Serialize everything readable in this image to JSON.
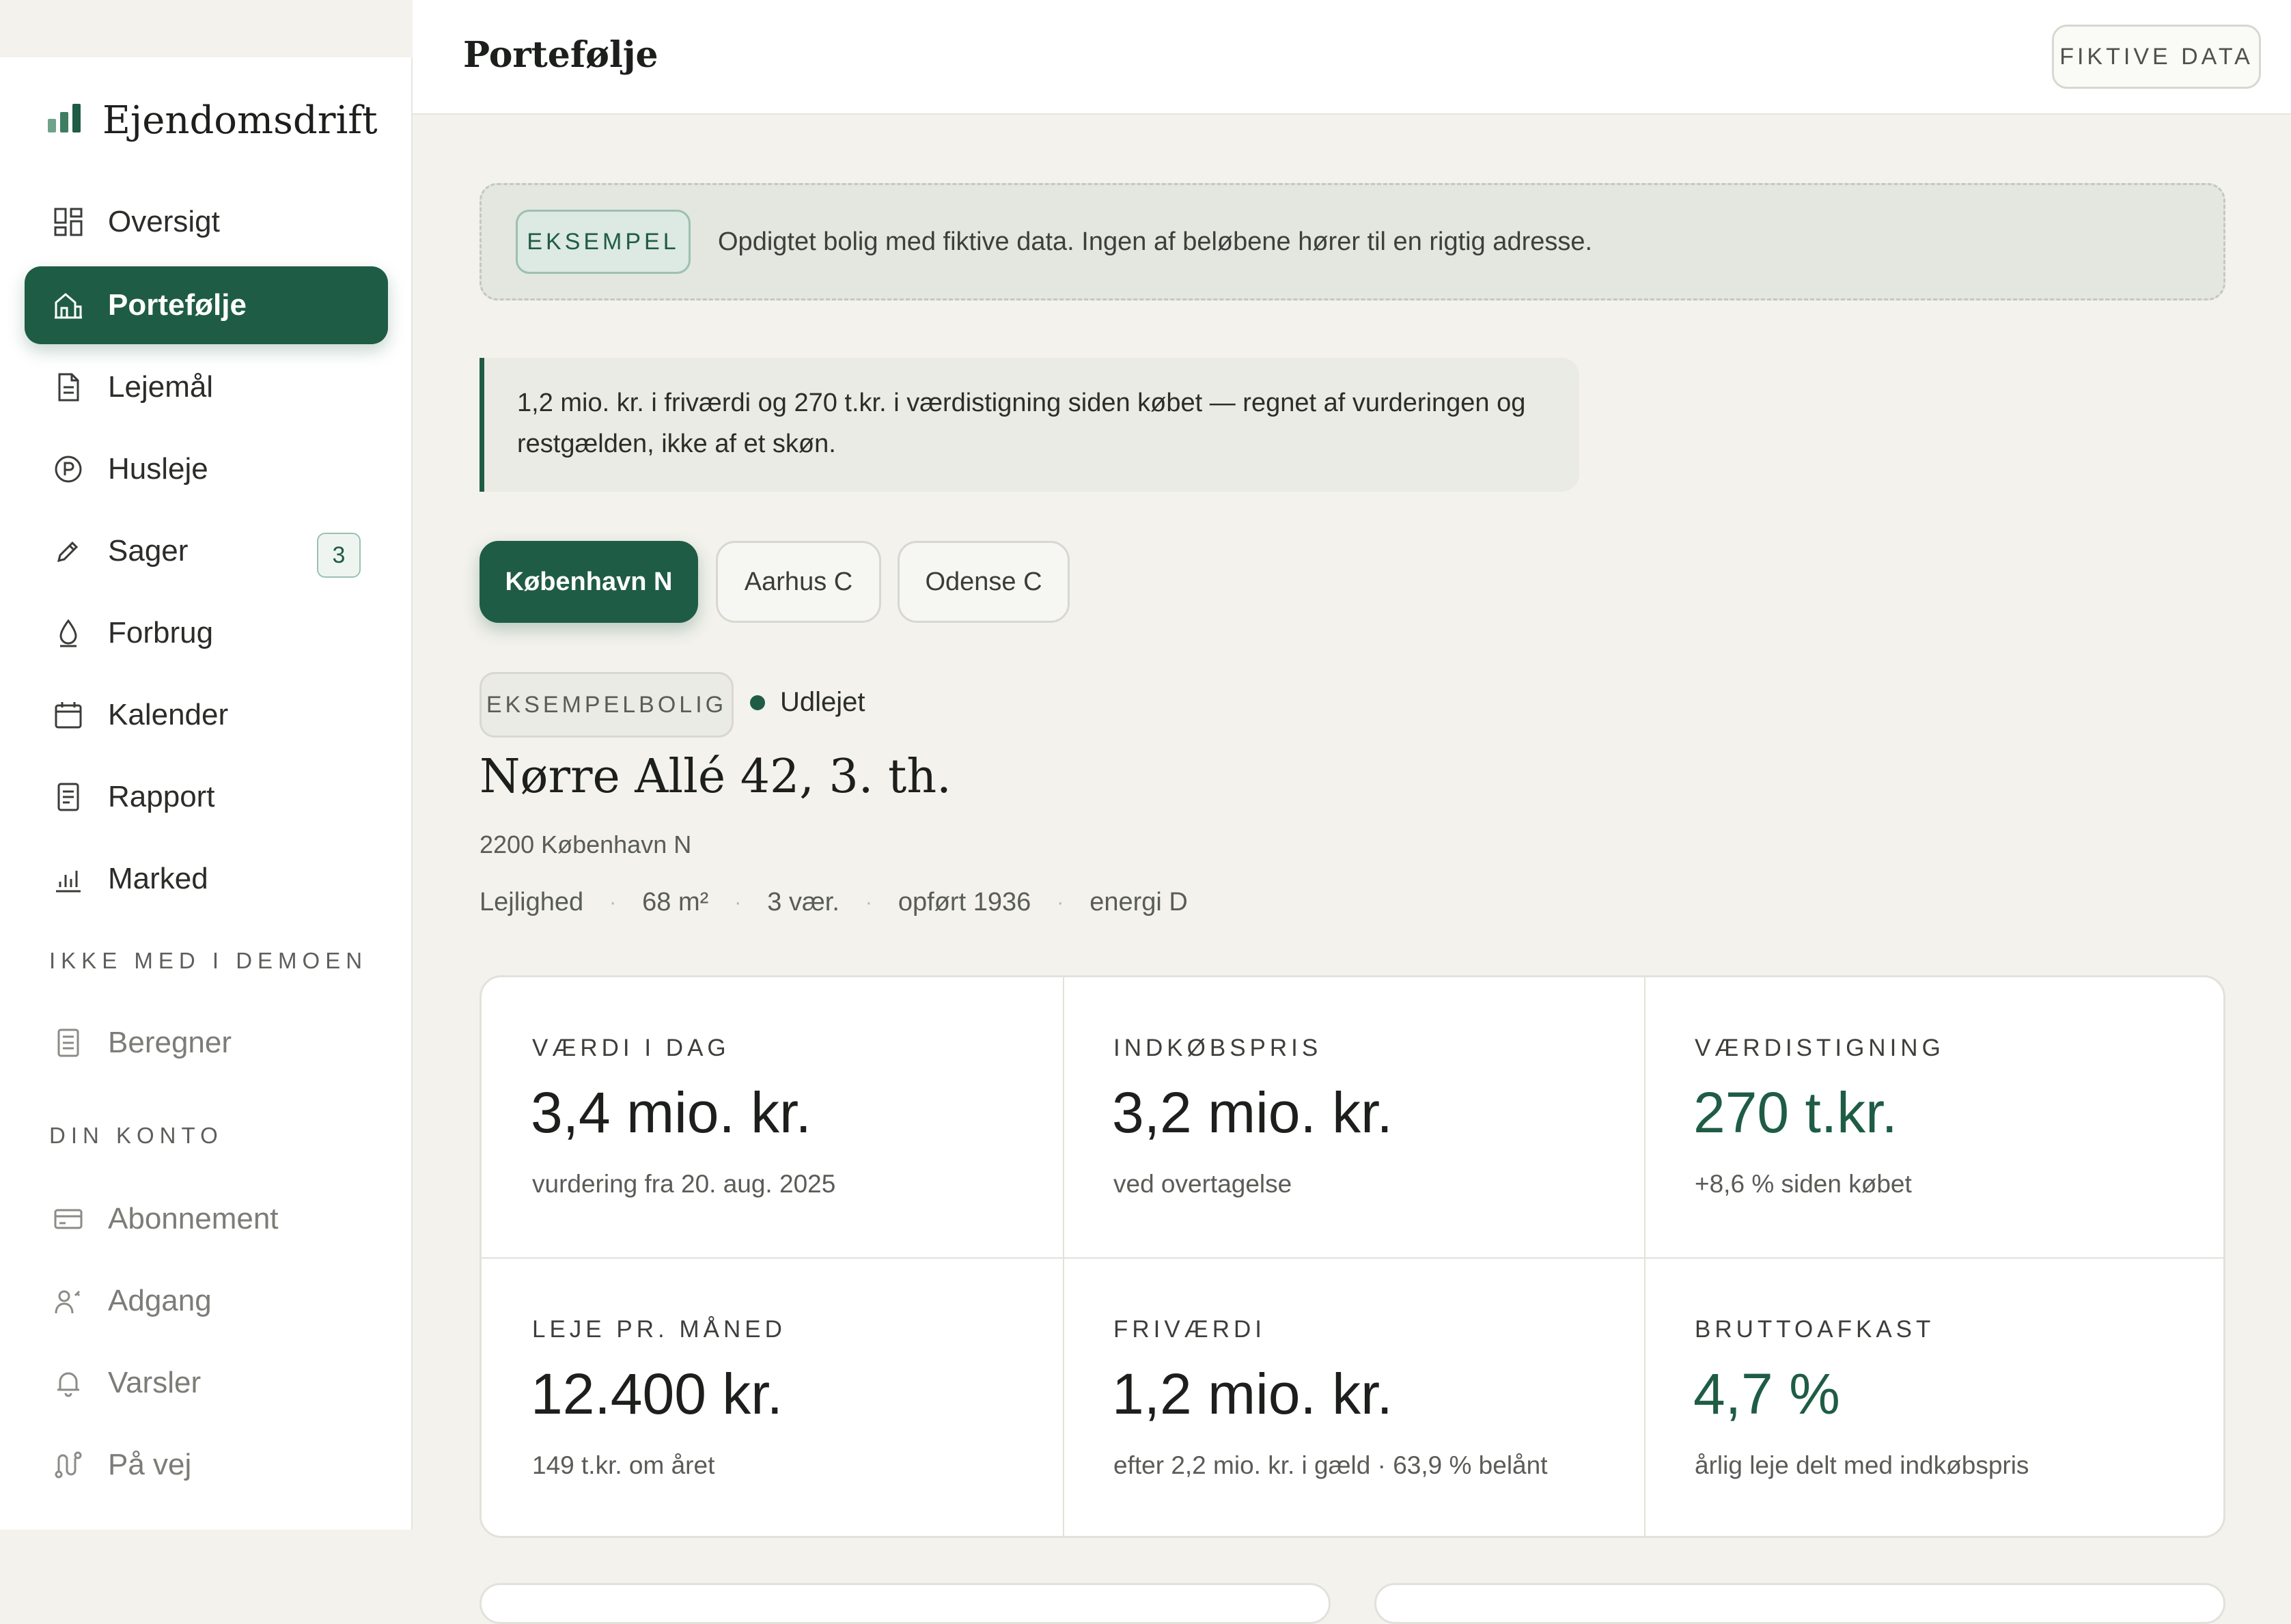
{
  "app": {
    "brand": "Ejendomsdrift",
    "colors": {
      "accent": "#1f5c45",
      "background": "#f3f2ed",
      "card": "#ffffff"
    }
  },
  "sidebar": {
    "items": [
      {
        "label": "Oversigt",
        "icon": "dashboard-icon"
      },
      {
        "label": "Portefølje",
        "icon": "building-icon",
        "active": true
      },
      {
        "label": "Lejemål",
        "icon": "document-icon"
      },
      {
        "label": "Husleje",
        "icon": "rent-coin-icon"
      },
      {
        "label": "Sager",
        "icon": "pencil-icon",
        "badge": "3"
      },
      {
        "label": "Forbrug",
        "icon": "drop-icon"
      },
      {
        "label": "Kalender",
        "icon": "calendar-icon"
      },
      {
        "label": "Rapport",
        "icon": "report-icon"
      },
      {
        "label": "Marked",
        "icon": "bar-chart-icon"
      }
    ],
    "section_demo": "IKKE MED I DEMOEN",
    "demo_items": [
      {
        "label": "Beregner",
        "icon": "calculator-icon"
      }
    ],
    "section_account": "DIN KONTO",
    "account_items": [
      {
        "label": "Abonnement",
        "icon": "card-icon"
      },
      {
        "label": "Adgang",
        "icon": "user-key-icon"
      },
      {
        "label": "Varsler",
        "icon": "bell-icon"
      },
      {
        "label": "På vej",
        "icon": "route-icon"
      }
    ]
  },
  "header": {
    "title": "Portefølje",
    "badge": "FIKTIVE DATA"
  },
  "notice": {
    "pill": "EKSEMPEL",
    "text": "Opdigtet bolig med fiktive data. Ingen af beløbene hører til en rigtig adresse."
  },
  "summary": {
    "line1": "1,2 mio. kr. i friværdi og 270 t.kr. i værdistigning siden købet — regnet af vurderingen og",
    "line2": "restgælden, ikke af et skøn."
  },
  "cities": [
    {
      "label": "København N",
      "active": true
    },
    {
      "label": "Aarhus C"
    },
    {
      "label": "Odense C"
    }
  ],
  "property": {
    "tag": "EKSEMPELBOLIG",
    "status": "Udlejet",
    "address": "Nørre Allé 42, 3. th.",
    "postal": "2200 København N",
    "facts": [
      "Lejlighed",
      "68 m²",
      "3 vær.",
      "opført 1936",
      "energi D"
    ]
  },
  "metrics": [
    {
      "label": "VÆRDI I DAG",
      "value": "3,4 mio. kr.",
      "sub": "vurdering fra 20. aug. 2025"
    },
    {
      "label": "INDKØBSPRIS",
      "value": "3,2 mio. kr.",
      "sub": "ved overtagelse"
    },
    {
      "label": "VÆRDISTIGNING",
      "value": "270 t.kr.",
      "sub": "+8,6 % siden købet",
      "accent": true
    },
    {
      "label": "LEJE PR. MÅNED",
      "value": "12.400 kr.",
      "sub": "149 t.kr. om året"
    },
    {
      "label": "FRIVÆRDI",
      "value": "1,2 mio. kr.",
      "sub": "efter 2,2 mio. kr. i gæld · 63,9 % belånt"
    },
    {
      "label": "BRUTTOAFKAST",
      "value": "4,7 %",
      "sub": "årlig leje delt med indkøbspris",
      "accent": true
    }
  ]
}
